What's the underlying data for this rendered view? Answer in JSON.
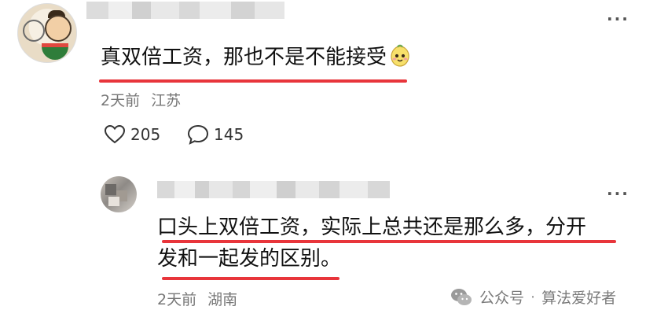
{
  "comment": {
    "text": "真双倍工资，那也不是不能接受",
    "emoji": "bean-face-emoji",
    "time": "2天前",
    "location": "江苏",
    "like_count": "205",
    "reply_count": "145"
  },
  "reply": {
    "text_line1": "口头上双倍工资，实际上总共还是那么多，分开",
    "text_line2": "发和一起发的区别。",
    "time": "2天前",
    "location": "湖南"
  },
  "watermark": {
    "source": "公众号",
    "separator": "·",
    "account": "算法爱好者"
  },
  "colors": {
    "underline": "#e8353b",
    "meta_text": "#777777"
  }
}
